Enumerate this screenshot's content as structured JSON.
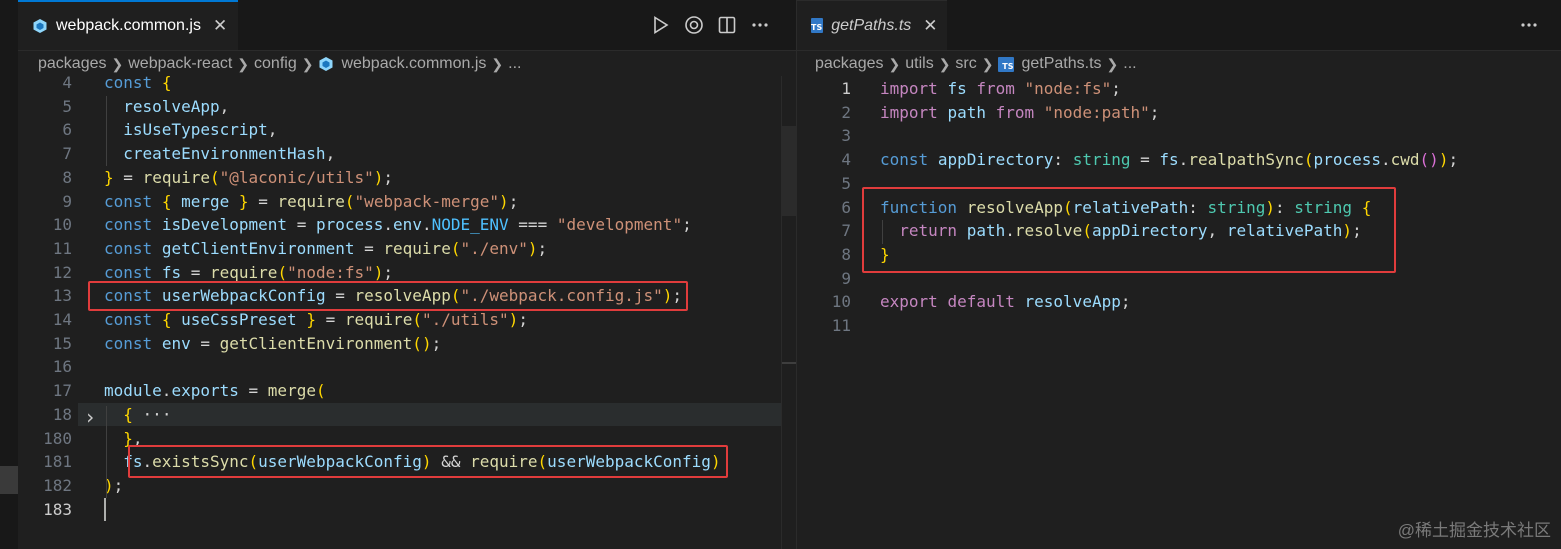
{
  "left_editor": {
    "tab_label": "webpack.common.js",
    "tab_close": "✕",
    "breadcrumb": [
      "packages",
      "webpack-react",
      "config",
      "webpack.common.js",
      "..."
    ],
    "actions": [
      "run-icon",
      "compare-icon",
      "split-editor-icon",
      "more-actions-icon"
    ],
    "lines": [
      {
        "n": "4",
        "code": "const {"
      },
      {
        "n": "5",
        "code": "  resolveApp,"
      },
      {
        "n": "6",
        "code": "  isUseTypescript,"
      },
      {
        "n": "7",
        "code": "  createEnvironmentHash,"
      },
      {
        "n": "8",
        "code": "} = require(\"@laconic/utils\");"
      },
      {
        "n": "9",
        "code": "const { merge } = require(\"webpack-merge\");"
      },
      {
        "n": "10",
        "code": "const isDevelopment = process.env.NODE_ENV === \"development\";"
      },
      {
        "n": "11",
        "code": "const getClientEnvironment = require(\"./env\");"
      },
      {
        "n": "12",
        "code": "const fs = require(\"node:fs\");"
      },
      {
        "n": "13",
        "code": "const userWebpackConfig = resolveApp(\"./webpack.config.js\");"
      },
      {
        "n": "14",
        "code": "const { useCssPreset } = require(\"./utils\");"
      },
      {
        "n": "15",
        "code": "const env = getClientEnvironment();"
      },
      {
        "n": "16",
        "code": ""
      },
      {
        "n": "17",
        "code": "module.exports = merge("
      },
      {
        "n": "18",
        "code": "  { ···"
      },
      {
        "n": "180",
        "code": "  },"
      },
      {
        "n": "181",
        "code": "  fs.existsSync(userWebpackConfig) && require(userWebpackConfig)"
      },
      {
        "n": "182",
        "code": ");"
      },
      {
        "n": "183",
        "code": ""
      }
    ]
  },
  "right_editor": {
    "tab_label": "getPaths.ts",
    "tab_close": "✕",
    "breadcrumb": [
      "packages",
      "utils",
      "src",
      "getPaths.ts",
      "..."
    ],
    "actions": [
      "more-actions-icon"
    ],
    "lines": [
      {
        "n": "1",
        "code": "import fs from \"node:fs\";"
      },
      {
        "n": "2",
        "code": "import path from \"node:path\";"
      },
      {
        "n": "3",
        "code": ""
      },
      {
        "n": "4",
        "code": "const appDirectory: string = fs.realpathSync(process.cwd());"
      },
      {
        "n": "5",
        "code": ""
      },
      {
        "n": "6",
        "code": "function resolveApp(relativePath: string): string {"
      },
      {
        "n": "7",
        "code": "  return path.resolve(appDirectory, relativePath);"
      },
      {
        "n": "8",
        "code": "}"
      },
      {
        "n": "9",
        "code": ""
      },
      {
        "n": "10",
        "code": "export default resolveApp;"
      },
      {
        "n": "11",
        "code": ""
      }
    ]
  },
  "ts_badge": "TS",
  "watermark": "@稀土掘金技术社区"
}
